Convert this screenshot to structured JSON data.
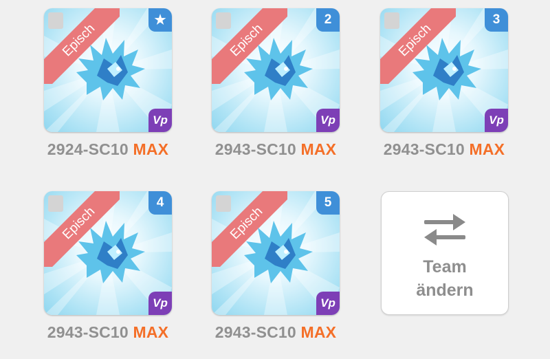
{
  "monsters": [
    {
      "rarity": "Episch",
      "badge": "★",
      "element": "Vp",
      "name": "2924-SC10",
      "level": "MAX"
    },
    {
      "rarity": "Episch",
      "badge": "2",
      "element": "Vp",
      "name": "2943-SC10",
      "level": "MAX"
    },
    {
      "rarity": "Episch",
      "badge": "3",
      "element": "Vp",
      "name": "2943-SC10",
      "level": "MAX"
    },
    {
      "rarity": "Episch",
      "badge": "4",
      "element": "Vp",
      "name": "2943-SC10",
      "level": "MAX"
    },
    {
      "rarity": "Episch",
      "badge": "5",
      "element": "Vp",
      "name": "2943-SC10",
      "level": "MAX"
    }
  ],
  "team_button": {
    "line1": "Team",
    "line2": "ändern",
    "icon": "swap-arrows-icon"
  },
  "colors": {
    "ribbon": "#e9797b",
    "badge": "#3f8fd8",
    "element": "#7d3fb6",
    "max": "#f46f28",
    "caption": "#909090"
  }
}
